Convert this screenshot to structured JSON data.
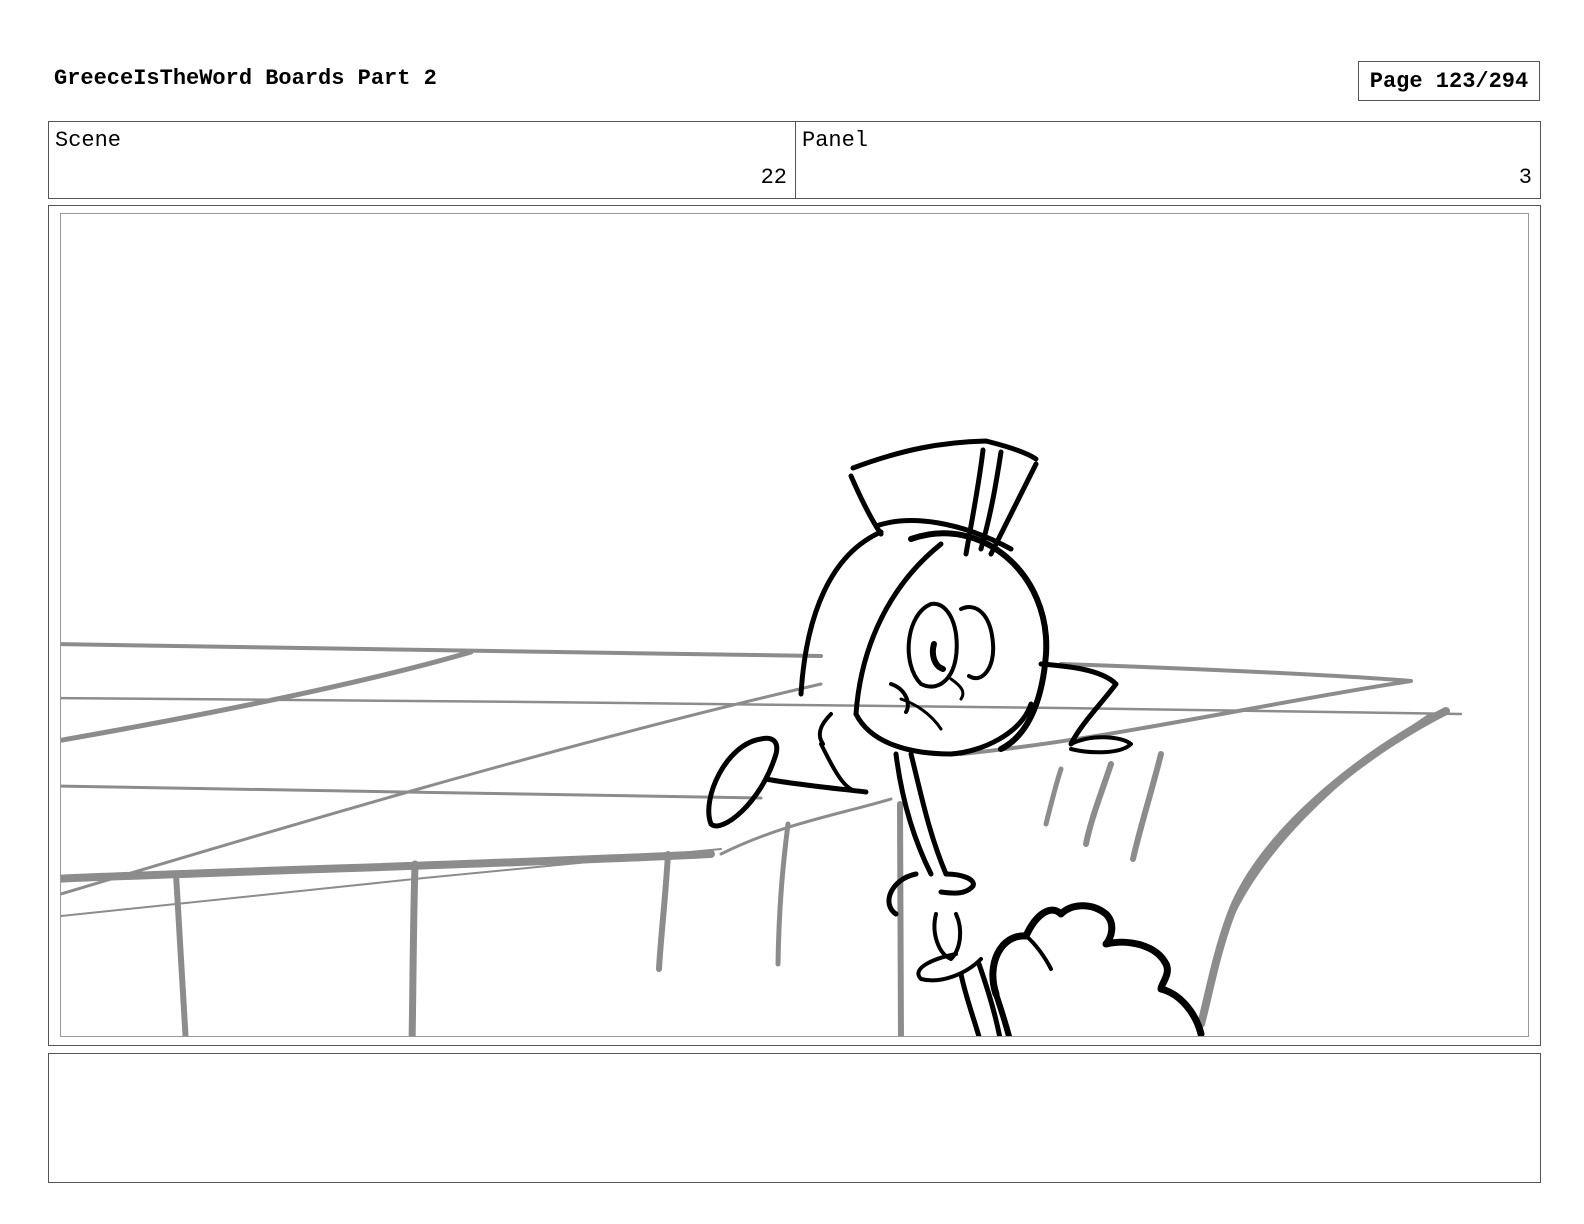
{
  "header": {
    "title": "GreeceIsTheWord Boards Part 2",
    "page_label": "Page 123/294"
  },
  "info": {
    "scene_label": "Scene",
    "scene_number": "22",
    "panel_label": "Panel",
    "panel_number": "3"
  },
  "notes": {
    "text": ""
  },
  "colors": {
    "ink": "#000000",
    "background_lines": "#8c8c8c",
    "border": "#555555"
  }
}
